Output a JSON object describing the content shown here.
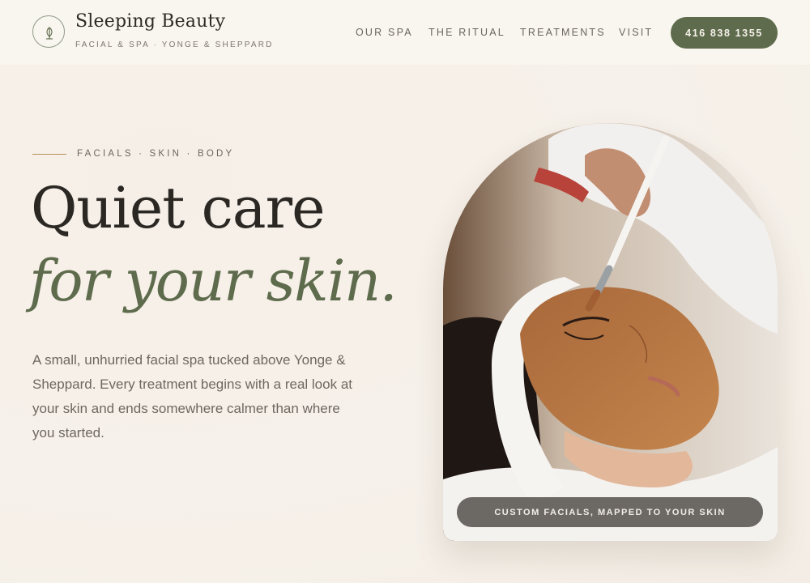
{
  "header": {
    "brand_name": "Sleeping Beauty",
    "brand_tagline": "FACIAL & SPA · YONGE & SHEPPARD",
    "nav": [
      {
        "label": "OUR SPA"
      },
      {
        "label": "THE RITUAL"
      },
      {
        "label": "TREATMENTS"
      },
      {
        "label": "VISIT"
      }
    ],
    "phone_label": "416 838 1355"
  },
  "hero": {
    "eyebrow": "FACIALS · SKIN · BODY",
    "headline_line1": "Quiet care",
    "headline_line2": "for your skin.",
    "body": "A small, unhurried facial spa tucked above Yonge & Sheppard. Every treatment begins with a real look at your skin and ends somewhere calmer than where you started.",
    "image_caption": "CUSTOM FACIALS, MAPPED TO YOUR SKIN"
  },
  "colors": {
    "background": "#f6f1ea",
    "accent_green": "#5e6b4c",
    "text_dark": "#2b2824",
    "eyebrow_line": "#b88f5c"
  },
  "icons": {
    "logo": "leaf-sprout-icon"
  }
}
